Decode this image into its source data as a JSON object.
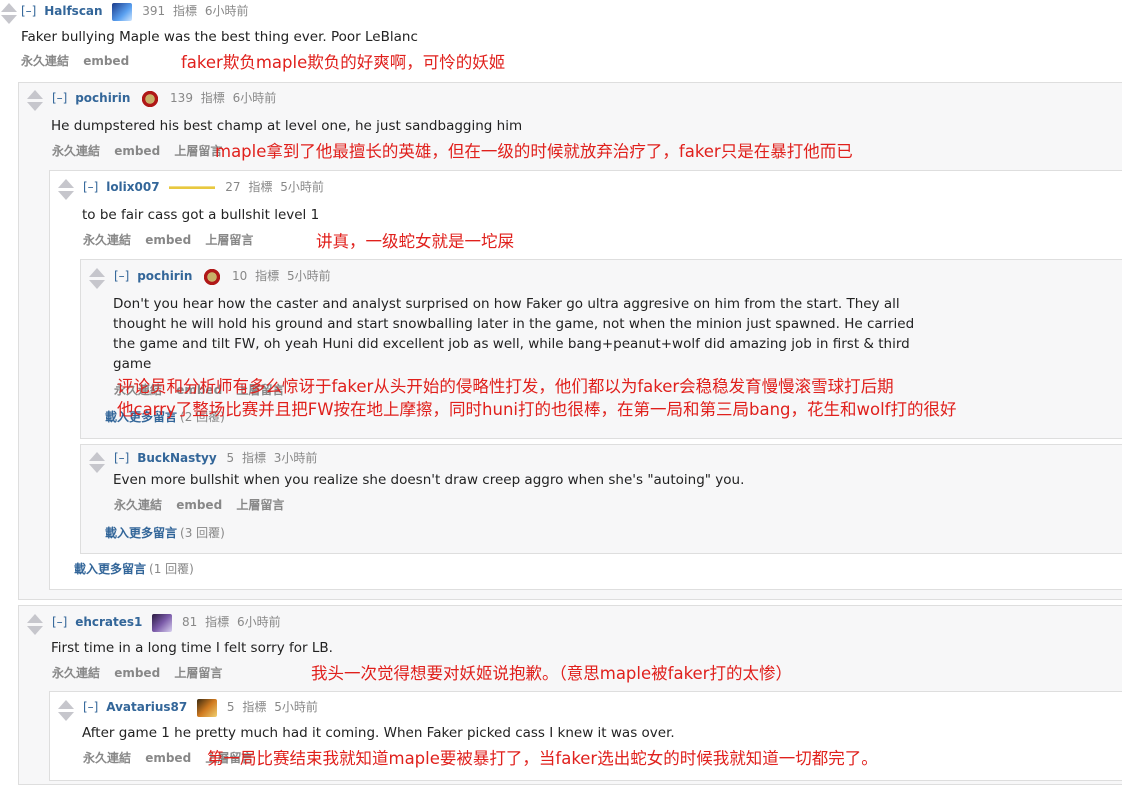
{
  "common": {
    "collapse": "[–]",
    "points_suffix": "指標",
    "permalink": "永久連結",
    "embed": "embed",
    "parent": "上層留言"
  },
  "comments": {
    "c1": {
      "author": "Halfscan",
      "score": "391",
      "time": "6小時前",
      "body": "Faker bullying Maple was the best thing ever. Poor LeBlanc",
      "flair_icon": "blue-crystal-icon"
    },
    "c2": {
      "author": "pochirin",
      "score": "139",
      "time": "6小時前",
      "body": "He dumpstered his best champ at level one, he just sandbagging him",
      "flair_icon": "skt-logo-icon"
    },
    "c3": {
      "author": "lolix007",
      "score": "27",
      "time": "5小時前",
      "body": "to be fair cass got a bullshit level 1",
      "flair_icon": "wings-icon"
    },
    "c4": {
      "author": "pochirin",
      "score": "10",
      "time": "5小時前",
      "body_lines": [
        "Don't you hear how the caster and analyst surprised on how Faker go ultra aggresive on him from the start. They all",
        "thought he will hold his ground and start snowballing later in the game, not when the minion just spawned. He carried",
        "the game and tilt FW, oh yeah Huni did excellent job as well, while bang+peanut+wolf did amazing job in first & third",
        "game"
      ],
      "flair_icon": "skt-logo-icon",
      "more_label": "載入更多留言",
      "more_count": "(2 回覆)"
    },
    "c5": {
      "author": "BuckNastyy",
      "score": "5",
      "time": "3小時前",
      "body": "Even more bullshit when you realize she doesn't draw creep aggro when she's \"autoing\" you.",
      "more_label": "載入更多留言",
      "more_count": "(3 回覆)"
    },
    "c3_more": {
      "label": "載入更多留言",
      "count": "(1 回覆)"
    },
    "c6": {
      "author": "ehcrates1",
      "score": "81",
      "time": "6小時前",
      "body": "First time in a long time I felt sorry for LB.",
      "flair_icon": "purple-champion-icon"
    },
    "c7": {
      "author": "Avatarius87",
      "score": "5",
      "time": "5小時前",
      "body": "After game 1 he pretty much had it coming. When Faker picked cass I knew it was over.",
      "flair_icon": "orange-champion-icon"
    }
  },
  "annotations": {
    "a1": "faker欺负maple欺负的好爽啊，可怜的妖姬",
    "a2": "maple拿到了他最擅长的英雄，但在一级的时候就放弃治疗了，faker只是在暴打他而已",
    "a3": "讲真，一级蛇女就是一坨屎",
    "a4_line1": "评论员和分析师有多么惊讶于faker从头开始的侵略性打发，他们都以为faker会稳稳发育慢慢滚雪球打后期",
    "a4_line2": "他carry了整场比赛并且把FW按在地上摩擦，同时huni打的也很棒，在第一局和第三局bang，花生和wolf打的很好",
    "a5": "我头一次觉得想要对妖姬说抱歉。（意思maple被faker打的太惨）",
    "a6": "第一局比赛结束我就知道maple要被暴打了，当faker选出蛇女的时候我就知道一切都完了。"
  },
  "colors": {
    "annotation": "#e0201c",
    "author": "#336699",
    "meta": "#888888",
    "box_bg": "#f7f7f8",
    "box_border": "#dedede"
  }
}
